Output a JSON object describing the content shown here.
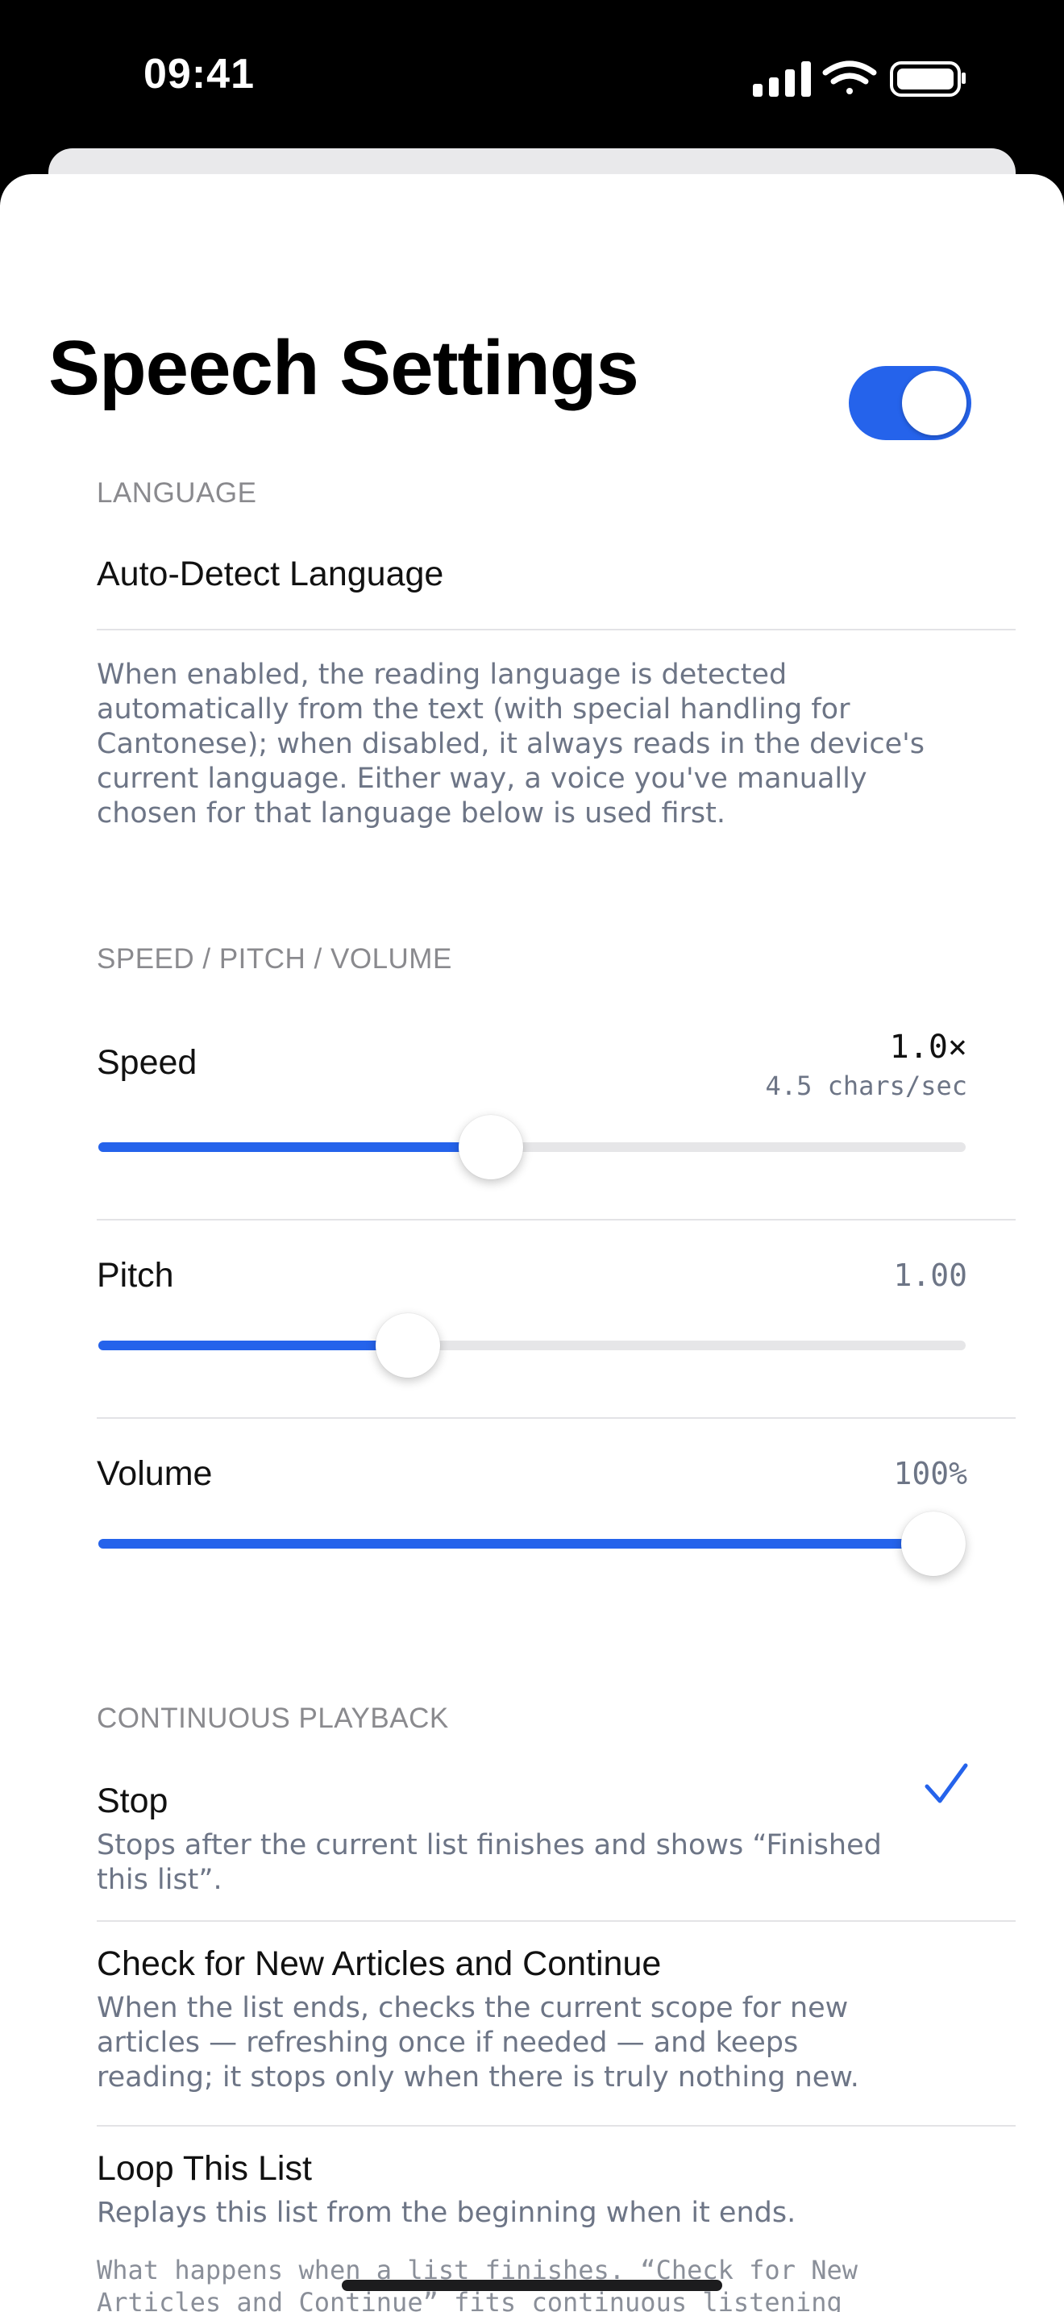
{
  "status_bar": {
    "time": "09:41"
  },
  "sheet": {
    "title": "Speech Settings"
  },
  "language": {
    "header": "LANGUAGE",
    "auto_detect_label": "Auto-Detect Language",
    "auto_detect_on": true,
    "footnote": "When enabled, the reading language is detected automatically from the text (with special handling for Cantonese); when disabled, it always reads in the device's current language. Either way, a voice you've manually chosen for that language below is used first."
  },
  "speed_pitch_volume": {
    "header": "SPEED / PITCH / VOLUME",
    "speed": {
      "label": "Speed",
      "value": "1.0×",
      "sub_value": "4.5 chars/sec",
      "fraction": 0.449
    },
    "pitch": {
      "label": "Pitch",
      "value": "1.00",
      "fraction": 0.345
    },
    "volume": {
      "label": "Volume",
      "value": "100%",
      "fraction": 1.0
    }
  },
  "continuous_playback": {
    "header": "CONTINUOUS PLAYBACK",
    "options": [
      {
        "title": "Stop",
        "description": "Stops after the current list finishes and shows “Finished this list”.",
        "selected": false
      },
      {
        "title": "Check for New Articles and Continue",
        "description": "When the list ends, checks the current scope for new articles — refreshing once if needed — and keeps reading; it stops only when there is truly nothing new.",
        "selected": true
      },
      {
        "title": "Loop This List",
        "description": "Replays this list from the beginning when it ends.",
        "selected": false
      }
    ],
    "footnote": "What happens when a list finishes. “Check for New Articles and Continue” fits continuous listening"
  },
  "colors": {
    "accent": "#2563eb",
    "secondary_text": "#6d7586",
    "header_text": "#8a8a8e"
  }
}
